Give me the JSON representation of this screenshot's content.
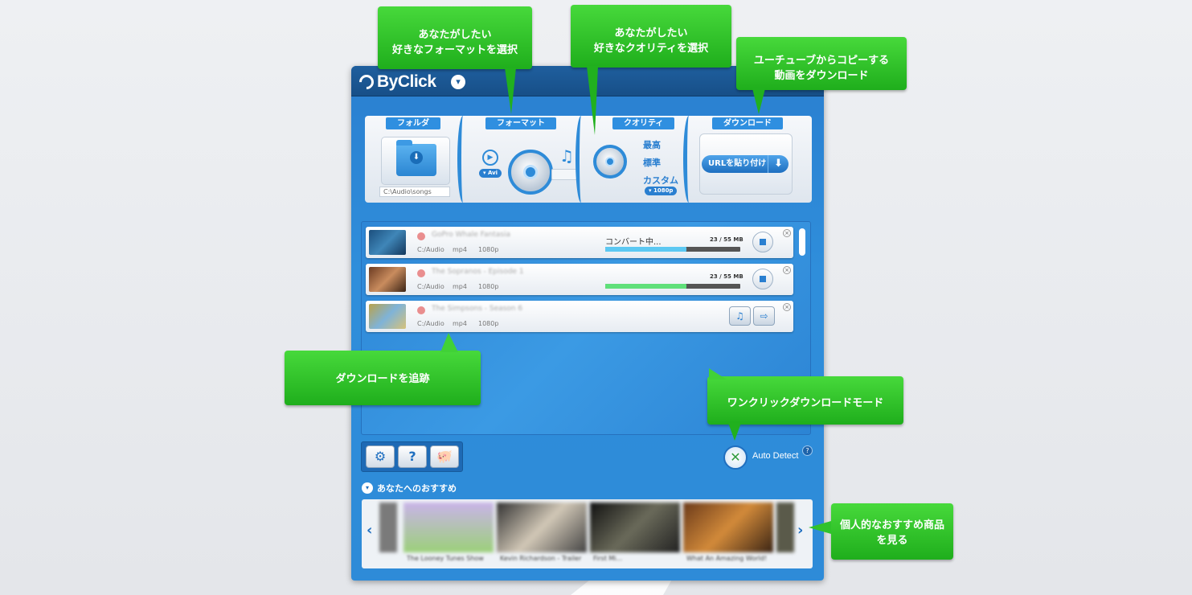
{
  "app": {
    "brand": "ByClick"
  },
  "panel": {
    "folder": {
      "label": "フォルダ",
      "path": "C:\\Audio\\songs"
    },
    "format": {
      "label": "フォーマット",
      "selected": "Avi"
    },
    "quality": {
      "label": "クオリティ",
      "options": [
        "最高",
        "標準",
        "カスタム"
      ],
      "custom_value": "1080p"
    },
    "download": {
      "label": "ダウンロード",
      "paste_button": "URLを貼り付け"
    }
  },
  "downloads": [
    {
      "title": "GoPro Whale Fantasia",
      "folder": "C:/Audio",
      "format": "mp4",
      "resolution": "1080p",
      "status": "コンバート中...",
      "size": "23 / 55 MB",
      "progress": 0.6,
      "bar_color": "#5cc8f2"
    },
    {
      "title": "The Sopranos - Episode 1",
      "folder": "C:/Audio",
      "format": "mp4",
      "resolution": "1080p",
      "status": "",
      "size": "23 / 55 MB",
      "progress": 0.6,
      "bar_color": "#5fe07a"
    },
    {
      "title": "The Simpsons - Season 6",
      "folder": "C:/Audio",
      "format": "mp4",
      "resolution": "1080p",
      "status": "",
      "size": "",
      "progress": 1.0,
      "bar_color": ""
    }
  ],
  "auto_detect": {
    "label": "Auto Detect",
    "help": "?"
  },
  "toolbar": {
    "help_label": "?"
  },
  "recommendations": {
    "title": "あなたへのおすすめ",
    "items": [
      {
        "title": "The Looney Tunes Show"
      },
      {
        "title": "Kevin Richardson - Trailer"
      },
      {
        "title": "First Mi..."
      },
      {
        "title": "What An Amazing World!"
      }
    ]
  },
  "callouts": {
    "format": [
      "あなたがしたい",
      "好きなフォーマットを選択"
    ],
    "quality": [
      "あなたがしたい",
      "好きなクオリティを選択"
    ],
    "download": [
      "ユーチューブからコピーする",
      "動画をダウンロード"
    ],
    "track": [
      "ダウンロードを追跡"
    ],
    "oneclick": [
      "ワンクリックダウンロードモード"
    ],
    "recommend": [
      "個人的なおすすめ商品",
      "を見る"
    ]
  }
}
